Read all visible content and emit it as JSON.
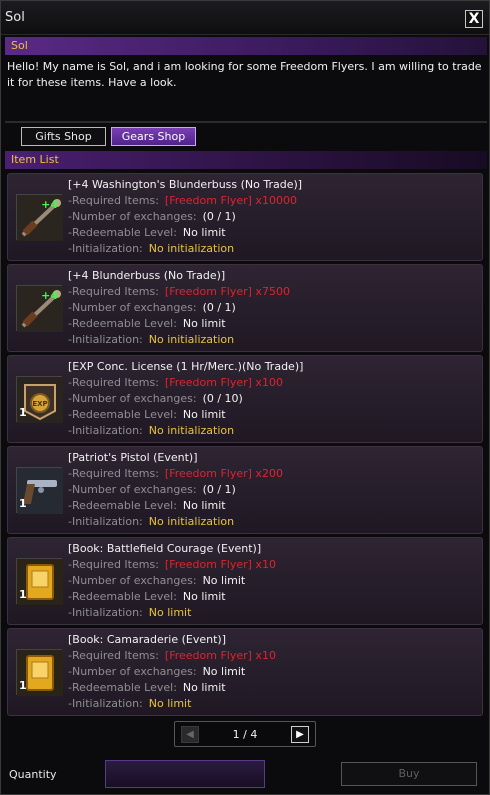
{
  "window": {
    "title": "Sol",
    "close_label": "X"
  },
  "npc": {
    "name": "Sol",
    "greeting": "Hello! My name is Sol, and i am looking for some Freedom Flyers. I am willing to trade it for these items. Have a look."
  },
  "tabs": [
    {
      "label": "Gifts Shop",
      "active": false
    },
    {
      "label": "Gears Shop",
      "active": true
    }
  ],
  "list": {
    "header": "Item List",
    "labels": {
      "required": "-Required Items:",
      "exchanges": "-Number of exchanges:",
      "level": "-Redeemable Level:",
      "init": "-Initialization:"
    },
    "items": [
      {
        "name": "[+4 Washington's Blunderbuss (No Trade)]",
        "required": "[Freedom Flyer] x10000",
        "exchanges": "(0 / 1)",
        "level": "No limit",
        "init": "No initialization",
        "icon": "blunderbuss-icon",
        "badge": "+4",
        "quantity": ""
      },
      {
        "name": "[+4 Blunderbuss (No Trade)]",
        "required": "[Freedom Flyer] x7500",
        "exchanges": "(0 / 1)",
        "level": "No limit",
        "init": "No initialization",
        "icon": "blunderbuss-icon",
        "badge": "+4",
        "quantity": ""
      },
      {
        "name": "[EXP Conc. License (1 Hr/Merc.)(No Trade)]",
        "required": "[Freedom Flyer] x100",
        "exchanges": "(0 / 10)",
        "level": "No limit",
        "init": "No initialization",
        "icon": "exp-license-icon",
        "badge": "",
        "quantity": "1"
      },
      {
        "name": "[Patriot's Pistol (Event)]",
        "required": "[Freedom Flyer] x200",
        "exchanges": "(0 / 1)",
        "level": "No limit",
        "init": "No initialization",
        "icon": "pistol-icon",
        "badge": "",
        "quantity": "1"
      },
      {
        "name": "[Book: Battlefield Courage (Event)]",
        "required": "[Freedom Flyer] x10",
        "exchanges": "No limit",
        "level": "No limit",
        "init": "No limit",
        "icon": "book-icon",
        "badge": "",
        "quantity": "1"
      },
      {
        "name": "[Book: Camaraderie (Event)]",
        "required": "[Freedom Flyer] x10",
        "exchanges": "No limit",
        "level": "No limit",
        "init": "No limit",
        "icon": "book-icon",
        "badge": "",
        "quantity": "1"
      }
    ]
  },
  "pager": {
    "page": "1 / 4"
  },
  "footer": {
    "quantity_label": "Quantity",
    "quantity_value": "",
    "buy_label": "Buy"
  },
  "colors": {
    "accent": "#5a2a86",
    "required_red": "#e0232d",
    "init_yellow": "#e8c43a",
    "badge_green": "#4df24d"
  }
}
